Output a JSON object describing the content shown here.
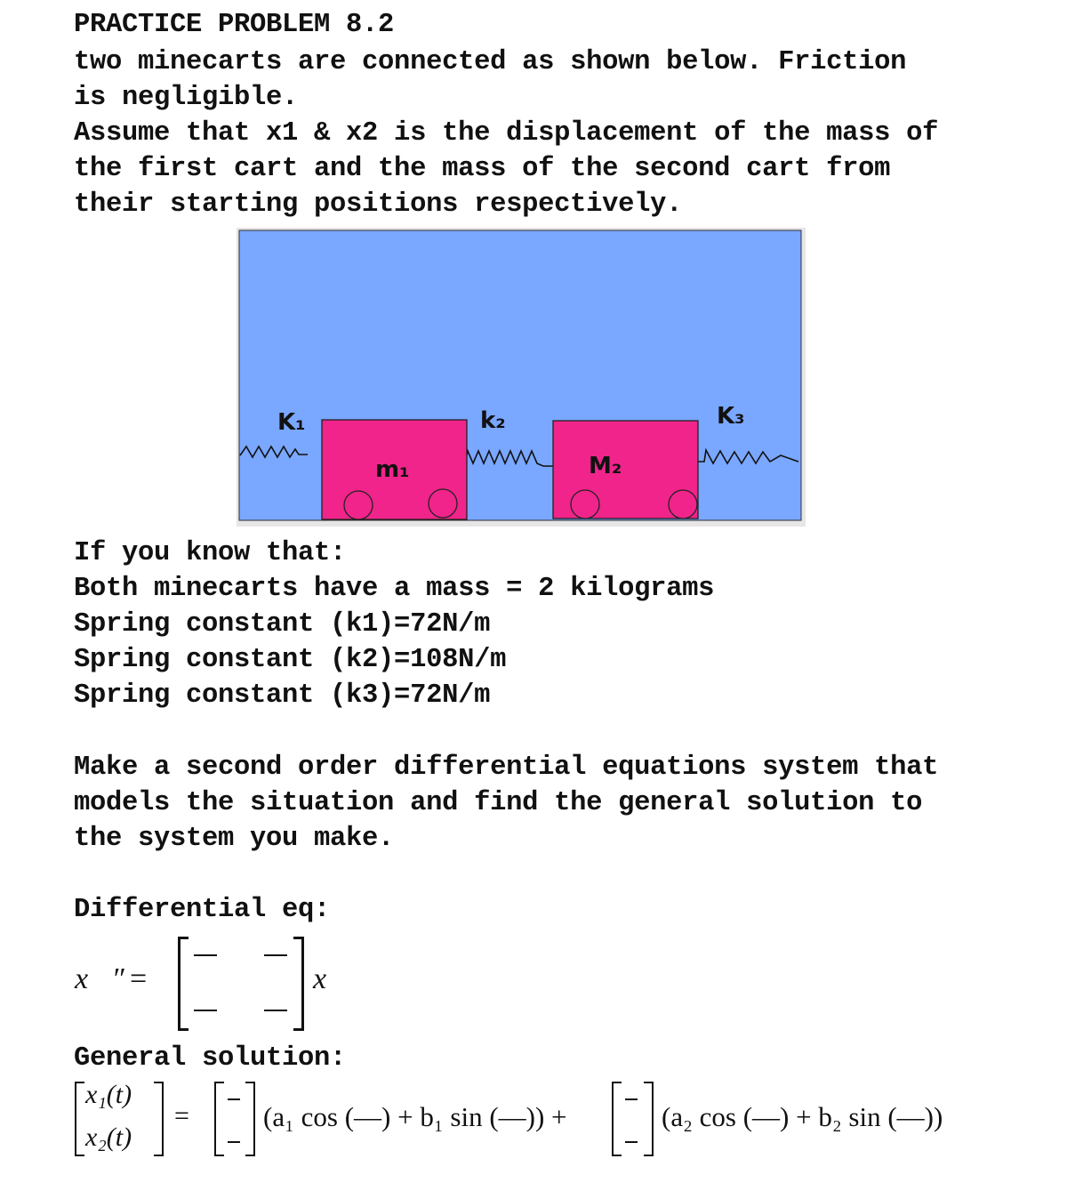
{
  "problem": {
    "title": "PRACTICE PROBLEM 8.2",
    "intro_lines": [
      "two minecarts are connected as shown below. Friction",
      "is negligible.",
      "Assume that x1 & x2 is the displacement of the mass of",
      "the first cart and the mass of the second cart from",
      "their starting positions respectively."
    ]
  },
  "diagram": {
    "background_color": "#7aa7ff",
    "cart_color": "#f0248a",
    "labels": {
      "k1": "K₁",
      "k2": "k₂",
      "k3": "K₃",
      "m1": "m₁",
      "m2": "M₂"
    }
  },
  "given": {
    "heading": "If you know that:",
    "lines": [
      "Both minecarts have a mass = 2 kilograms",
      "Spring constant (k1)=72N/m",
      "Spring constant (k2)=108N/m",
      "Spring constant (k3)=72N/m"
    ]
  },
  "task": {
    "lines": [
      "Make a second order differential equations system that",
      "models the situation and find the general solution to",
      "the system you make."
    ]
  },
  "differential": {
    "heading": "Differential eq:",
    "lhs": "x⃗″",
    "equals": "=",
    "rhs_vector": "x⃗",
    "blank": "—"
  },
  "solution": {
    "heading": "General solution:",
    "x1": "x₁(t)",
    "x2": "x₂(t)",
    "equals": "=",
    "term1": "(a₁ cos (—) + b₁ sin (—)) +",
    "term2": "(a₂ cos (—) + b₂ sin (—))",
    "blank": "—"
  }
}
